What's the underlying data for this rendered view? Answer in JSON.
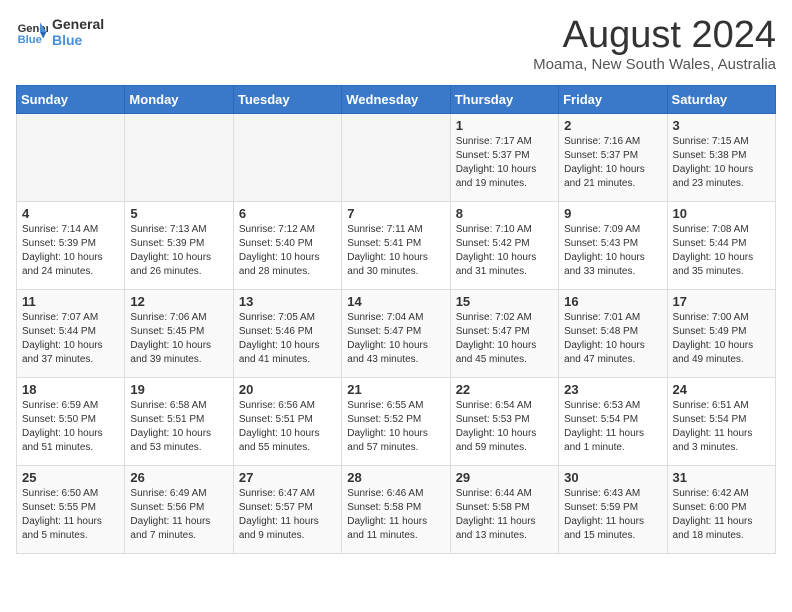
{
  "header": {
    "logo_line1": "General",
    "logo_line2": "Blue",
    "title": "August 2024",
    "subtitle": "Moama, New South Wales, Australia"
  },
  "days_of_week": [
    "Sunday",
    "Monday",
    "Tuesday",
    "Wednesday",
    "Thursday",
    "Friday",
    "Saturday"
  ],
  "weeks": [
    [
      {
        "num": "",
        "info": ""
      },
      {
        "num": "",
        "info": ""
      },
      {
        "num": "",
        "info": ""
      },
      {
        "num": "",
        "info": ""
      },
      {
        "num": "1",
        "info": "Sunrise: 7:17 AM\nSunset: 5:37 PM\nDaylight: 10 hours\nand 19 minutes."
      },
      {
        "num": "2",
        "info": "Sunrise: 7:16 AM\nSunset: 5:37 PM\nDaylight: 10 hours\nand 21 minutes."
      },
      {
        "num": "3",
        "info": "Sunrise: 7:15 AM\nSunset: 5:38 PM\nDaylight: 10 hours\nand 23 minutes."
      }
    ],
    [
      {
        "num": "4",
        "info": "Sunrise: 7:14 AM\nSunset: 5:39 PM\nDaylight: 10 hours\nand 24 minutes."
      },
      {
        "num": "5",
        "info": "Sunrise: 7:13 AM\nSunset: 5:39 PM\nDaylight: 10 hours\nand 26 minutes."
      },
      {
        "num": "6",
        "info": "Sunrise: 7:12 AM\nSunset: 5:40 PM\nDaylight: 10 hours\nand 28 minutes."
      },
      {
        "num": "7",
        "info": "Sunrise: 7:11 AM\nSunset: 5:41 PM\nDaylight: 10 hours\nand 30 minutes."
      },
      {
        "num": "8",
        "info": "Sunrise: 7:10 AM\nSunset: 5:42 PM\nDaylight: 10 hours\nand 31 minutes."
      },
      {
        "num": "9",
        "info": "Sunrise: 7:09 AM\nSunset: 5:43 PM\nDaylight: 10 hours\nand 33 minutes."
      },
      {
        "num": "10",
        "info": "Sunrise: 7:08 AM\nSunset: 5:44 PM\nDaylight: 10 hours\nand 35 minutes."
      }
    ],
    [
      {
        "num": "11",
        "info": "Sunrise: 7:07 AM\nSunset: 5:44 PM\nDaylight: 10 hours\nand 37 minutes."
      },
      {
        "num": "12",
        "info": "Sunrise: 7:06 AM\nSunset: 5:45 PM\nDaylight: 10 hours\nand 39 minutes."
      },
      {
        "num": "13",
        "info": "Sunrise: 7:05 AM\nSunset: 5:46 PM\nDaylight: 10 hours\nand 41 minutes."
      },
      {
        "num": "14",
        "info": "Sunrise: 7:04 AM\nSunset: 5:47 PM\nDaylight: 10 hours\nand 43 minutes."
      },
      {
        "num": "15",
        "info": "Sunrise: 7:02 AM\nSunset: 5:47 PM\nDaylight: 10 hours\nand 45 minutes."
      },
      {
        "num": "16",
        "info": "Sunrise: 7:01 AM\nSunset: 5:48 PM\nDaylight: 10 hours\nand 47 minutes."
      },
      {
        "num": "17",
        "info": "Sunrise: 7:00 AM\nSunset: 5:49 PM\nDaylight: 10 hours\nand 49 minutes."
      }
    ],
    [
      {
        "num": "18",
        "info": "Sunrise: 6:59 AM\nSunset: 5:50 PM\nDaylight: 10 hours\nand 51 minutes."
      },
      {
        "num": "19",
        "info": "Sunrise: 6:58 AM\nSunset: 5:51 PM\nDaylight: 10 hours\nand 53 minutes."
      },
      {
        "num": "20",
        "info": "Sunrise: 6:56 AM\nSunset: 5:51 PM\nDaylight: 10 hours\nand 55 minutes."
      },
      {
        "num": "21",
        "info": "Sunrise: 6:55 AM\nSunset: 5:52 PM\nDaylight: 10 hours\nand 57 minutes."
      },
      {
        "num": "22",
        "info": "Sunrise: 6:54 AM\nSunset: 5:53 PM\nDaylight: 10 hours\nand 59 minutes."
      },
      {
        "num": "23",
        "info": "Sunrise: 6:53 AM\nSunset: 5:54 PM\nDaylight: 11 hours\nand 1 minute."
      },
      {
        "num": "24",
        "info": "Sunrise: 6:51 AM\nSunset: 5:54 PM\nDaylight: 11 hours\nand 3 minutes."
      }
    ],
    [
      {
        "num": "25",
        "info": "Sunrise: 6:50 AM\nSunset: 5:55 PM\nDaylight: 11 hours\nand 5 minutes."
      },
      {
        "num": "26",
        "info": "Sunrise: 6:49 AM\nSunset: 5:56 PM\nDaylight: 11 hours\nand 7 minutes."
      },
      {
        "num": "27",
        "info": "Sunrise: 6:47 AM\nSunset: 5:57 PM\nDaylight: 11 hours\nand 9 minutes."
      },
      {
        "num": "28",
        "info": "Sunrise: 6:46 AM\nSunset: 5:58 PM\nDaylight: 11 hours\nand 11 minutes."
      },
      {
        "num": "29",
        "info": "Sunrise: 6:44 AM\nSunset: 5:58 PM\nDaylight: 11 hours\nand 13 minutes."
      },
      {
        "num": "30",
        "info": "Sunrise: 6:43 AM\nSunset: 5:59 PM\nDaylight: 11 hours\nand 15 minutes."
      },
      {
        "num": "31",
        "info": "Sunrise: 6:42 AM\nSunset: 6:00 PM\nDaylight: 11 hours\nand 18 minutes."
      }
    ]
  ]
}
